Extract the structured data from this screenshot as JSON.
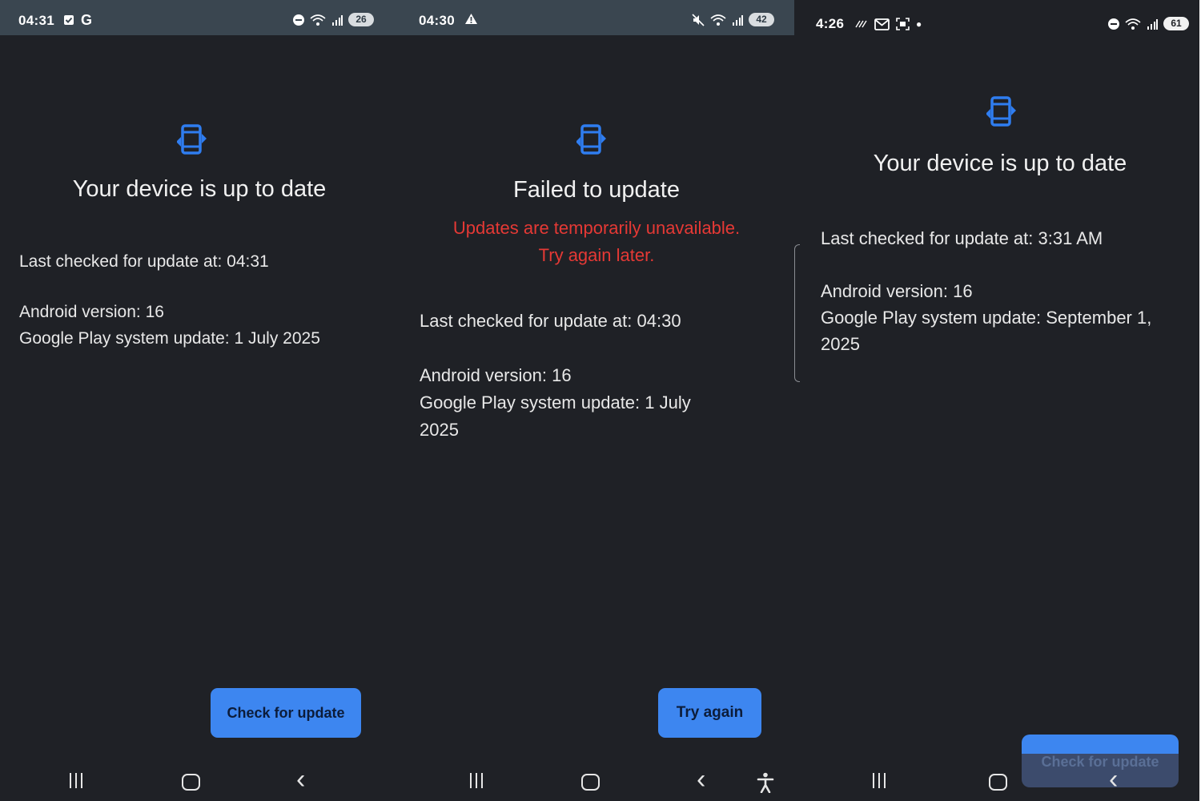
{
  "screens": [
    {
      "status_bar": {
        "time": "04:31",
        "left_icons": [
          "checkbox-icon",
          "google-g-icon"
        ],
        "google_letter": "G",
        "battery": "26"
      },
      "title": "Your device is up to date",
      "last_checked": "Last checked for update at: 04:31",
      "android_version": "Android version: 16",
      "play_update": "Google Play system update: 1 July 2025",
      "button_label": "Check for update"
    },
    {
      "status_bar": {
        "time": "04:30",
        "left_icons": [
          "warning-icon"
        ],
        "battery": "42"
      },
      "title": "Failed to update",
      "error_line1": "Updates are temporarily unavailable.",
      "error_line2": "Try again later.",
      "last_checked": "Last checked for update at: 04:30",
      "android_version": "Android version: 16",
      "play_update_line1": "Google Play system update: 1 July",
      "play_update_line2": "2025",
      "button_label": "Try again"
    },
    {
      "status_bar": {
        "time": "4:26",
        "left_icons": [
          "call-forward-icon",
          "gmail-icon",
          "screenshot-icon",
          "dot-icon"
        ],
        "battery": "61"
      },
      "title": "Your device is up to date",
      "last_checked": "Last checked for update at: 3:31 AM",
      "android_version": "Android version: 16",
      "play_update_line1": "Google Play system update: September 1,",
      "play_update_line2": "2025",
      "button_label": "Check for update"
    }
  ],
  "colors": {
    "background": "#1f2126",
    "status_bar": "#3a4650",
    "accent_blue": "#3d86f0",
    "icon_blue": "#2f7df0",
    "error_red": "#e53935",
    "text": "#f1f1f1"
  }
}
